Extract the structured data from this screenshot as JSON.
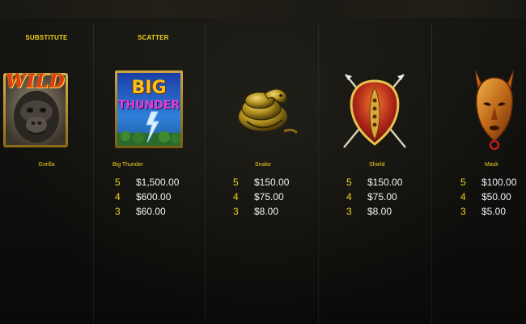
{
  "columns": [
    {
      "category": "SUBSTITUTE",
      "symbol_name": "Gorilla",
      "icon": "wild-gorilla-icon",
      "badge_text": "WILD",
      "pays": []
    },
    {
      "category": "SCATTER",
      "symbol_name": "Big Thunder",
      "icon": "big-thunder-icon",
      "logo_lines": [
        "BIG",
        "THUNDER"
      ],
      "pays": [
        {
          "count": "5",
          "value": "$1,500.00"
        },
        {
          "count": "4",
          "value": "$600.00"
        },
        {
          "count": "3",
          "value": "$60.00"
        }
      ]
    },
    {
      "category": "",
      "symbol_name": "Snake",
      "icon": "snake-icon",
      "pays": [
        {
          "count": "5",
          "value": "$150.00"
        },
        {
          "count": "4",
          "value": "$75.00"
        },
        {
          "count": "3",
          "value": "$8.00"
        }
      ]
    },
    {
      "category": "",
      "symbol_name": "Shield",
      "icon": "shield-icon",
      "pays": [
        {
          "count": "5",
          "value": "$150.00"
        },
        {
          "count": "4",
          "value": "$75.00"
        },
        {
          "count": "3",
          "value": "$8.00"
        }
      ]
    },
    {
      "category": "",
      "symbol_name": "Mask",
      "icon": "mask-icon",
      "pays": [
        {
          "count": "5",
          "value": "$100.00"
        },
        {
          "count": "4",
          "value": "$50.00"
        },
        {
          "count": "3",
          "value": "$5.00"
        }
      ]
    }
  ],
  "colors": {
    "label_yellow": "#f2d21c",
    "value_white": "#f2f2f2",
    "background": "#0e0e0c"
  }
}
